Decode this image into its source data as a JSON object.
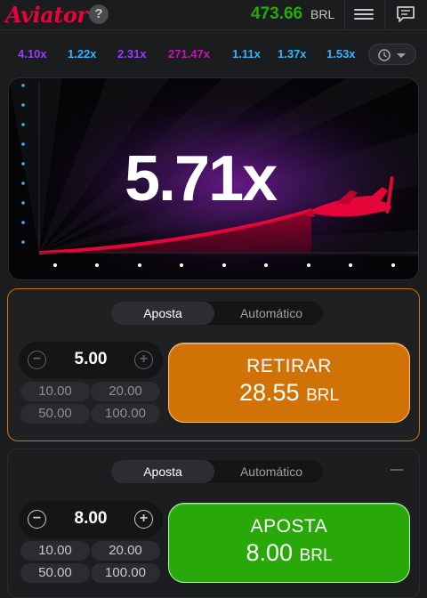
{
  "header": {
    "logo": "Aviator",
    "help": "?",
    "balance": "473.66",
    "currency": "BRL"
  },
  "history": [
    {
      "value": "4.10x",
      "color": "#913ef8"
    },
    {
      "value": "1.22x",
      "color": "#34b4ff"
    },
    {
      "value": "2.31x",
      "color": "#913ef8"
    },
    {
      "value": "271.47x",
      "color": "#c017b4"
    },
    {
      "value": "1.11x",
      "color": "#34b4ff"
    },
    {
      "value": "1.37x",
      "color": "#34b4ff"
    },
    {
      "value": "1.53x",
      "color": "#34b4ff"
    }
  ],
  "game": {
    "multiplier": "5.71x"
  },
  "bet1": {
    "tab_bet": "Aposta",
    "tab_auto": "Automático",
    "stake": "5.00",
    "quick": [
      "10.00",
      "20.00",
      "50.00",
      "100.00"
    ],
    "button_line1": "RETIRAR",
    "button_amount": "28.55",
    "button_currency": "BRL"
  },
  "bet2": {
    "tab_bet": "Aposta",
    "tab_auto": "Automático",
    "stake": "8.00",
    "quick": [
      "10.00",
      "20.00",
      "50.00",
      "100.00"
    ],
    "button_line1": "APOSTA",
    "button_amount": "8.00",
    "button_currency": "BRL"
  },
  "colors": {
    "accent_red": "#e50539",
    "balance_green": "#28a909",
    "cashout_orange": "#d07206",
    "bet_green": "#28a909"
  }
}
